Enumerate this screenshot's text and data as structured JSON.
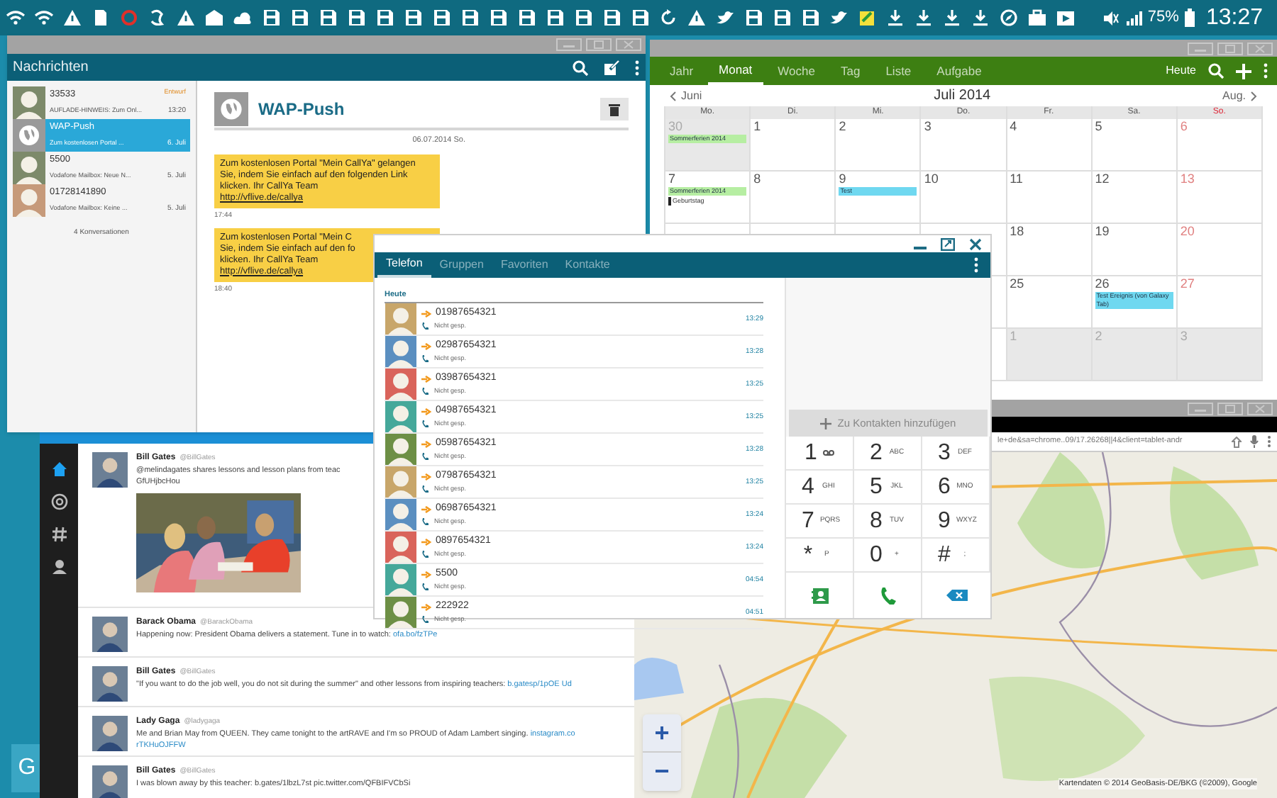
{
  "status_bar": {
    "battery": "75%",
    "time": "13:27"
  },
  "calendar": {
    "tabs": [
      {
        "label": "Jahr",
        "selected": false
      },
      {
        "label": "Monat",
        "selected": true
      },
      {
        "label": "Woche",
        "selected": false
      },
      {
        "label": "Tag",
        "selected": false
      },
      {
        "label": "Liste",
        "selected": false
      },
      {
        "label": "Aufgabe",
        "selected": false
      }
    ],
    "today": "Heute",
    "prev": "Juni",
    "month": "Juli 2014",
    "next": "Aug.",
    "weekdays": [
      "Mo.",
      "Di.",
      "Mi.",
      "Do.",
      "Fr.",
      "Sa.",
      "So."
    ],
    "weeks": [
      {
        "days": [
          {
            "day": "30",
            "other_month": true,
            "events": [
              {
                "text": "Sommerferien 2014",
                "color": "#b6eea2"
              }
            ]
          },
          {
            "day": "1",
            "other_month": false
          },
          {
            "day": "2",
            "other_month": false
          },
          {
            "day": "3",
            "other_month": false
          },
          {
            "day": "4",
            "other_month": false
          },
          {
            "day": "5",
            "other_month": false
          },
          {
            "day": "6",
            "other_month": false
          }
        ]
      },
      {
        "days": [
          {
            "day": "7",
            "other_month": false,
            "events": [
              {
                "text": "Sommerferien 2014",
                "color": "#b6eea2"
              },
              {
                "text": "Geburtstag",
                "color": "#222222"
              }
            ]
          },
          {
            "day": "8",
            "other_month": false
          },
          {
            "day": "9",
            "other_month": false,
            "events": [
              {
                "text": "Test",
                "color": "#6fd8f0"
              }
            ]
          },
          {
            "day": "10",
            "other_month": false
          },
          {
            "day": "11",
            "other_month": false
          },
          {
            "day": "12",
            "other_month": false
          },
          {
            "day": "13",
            "other_month": false
          }
        ]
      },
      {
        "days": [
          {
            "day": "18",
            "other_month": false
          },
          {
            "day": "19",
            "other_month": false
          },
          {
            "day": "20",
            "other_month": false
          }
        ]
      },
      {
        "days": [
          {
            "day": "25",
            "other_month": false
          },
          {
            "day": "26",
            "other_month": false,
            "events": [
              {
                "text": "Test Ereignis (von Galaxy Tab)",
                "color": "#6fd8f0"
              }
            ]
          },
          {
            "day": "27",
            "other_month": false
          }
        ]
      },
      {
        "days": [
          {
            "day": "1",
            "other_month": true
          },
          {
            "day": "2",
            "other_month": true
          },
          {
            "day": "3",
            "other_month": true
          }
        ]
      }
    ]
  },
  "twitter": {
    "tweets": [
      {
        "name": "Bill Gates",
        "handle": "@BillGates",
        "lines": [
          {
            "text": "@melindagates shares lessons and lesson plans from teac"
          },
          {
            "text": "GfUHjbcHou"
          }
        ],
        "picture": true
      },
      {
        "name": "Barack Obama",
        "handle": "@BarackObama",
        "lines": [
          {
            "text": "Happening now: President Obama delivers a statement. Tune in to watch:",
            "link": "ofa.bo/fzTPe"
          }
        ],
        "picture": false
      },
      {
        "name": "Bill Gates",
        "handle": "@BillGates",
        "lines": [
          {
            "text": "\"If you want to do the job well, you do not sit during the summer\" and other lessons from inspiring teachers:",
            "link": "b.gatesp/1pOE Ud"
          }
        ],
        "picture": false
      },
      {
        "name": "Lady Gaga",
        "handle": "@ladygaga",
        "lines": [
          {
            "text": "Me and Brian May from QUEEN. They came tonight to the artRAVE and I'm so PROUD of Adam Lambert singing.",
            "link": "instagram.co"
          },
          {
            "link": "rTKHuOJFFW"
          }
        ],
        "picture": false
      },
      {
        "name": "Bill Gates",
        "handle": "@BillGates",
        "lines": [
          {
            "text": "I was blown away by this teacher: b.gates/1lbzL7st pic.twitter.com/QFBIFVCbSi"
          }
        ],
        "picture": false
      }
    ]
  },
  "messages": {
    "title": "Nachrichten",
    "conversations": [
      {
        "name": "33533",
        "tag": "Entwurf",
        "snippet": "AUFLADE-HINWEIS: Zum Onl...",
        "time": "13:20",
        "selected": false,
        "kind": "person"
      },
      {
        "name": "WAP-Push",
        "snippet": "Zum kostenlosen Portal ...",
        "time": "6. Juli",
        "selected": true,
        "kind": "globe"
      },
      {
        "name": "5500",
        "snippet": "Vodafone Mailbox: Neue N...",
        "time": "5. Juli",
        "selected": false,
        "kind": "person"
      },
      {
        "name": "01728141890",
        "snippet": "Vodafone Mailbox: Keine ...",
        "time": "5. Juli",
        "selected": false,
        "kind": "person"
      }
    ],
    "count": "4 Konversationen",
    "thread": {
      "title": "WAP-Push",
      "date": "06.07.2014 So.",
      "messages": [
        {
          "lines": [
            "Zum kostenlosen Portal \"Mein CallYa\" gelangen",
            "Sie, indem Sie einfach auf den folgenden Link",
            "klicken. Ihr CallYa Team"
          ],
          "link": "http://vflive.de/callya",
          "time": "17:44"
        },
        {
          "lines": [
            "Zum kostenlosen Portal \"Mein C",
            "Sie, indem Sie einfach auf den fo",
            "klicken. Ihr CallYa Team"
          ],
          "link": "http://vflive.de/callya",
          "time": "18:40"
        }
      ]
    }
  },
  "map": {
    "url": "le+de&sa=chrome..09/17.26268||4&client=tablet-andr",
    "attribution": "Kartendaten © 2014 GeoBasis-DE/BKG (©2009), Google",
    "zoom_in": "+",
    "zoom_out": "−"
  },
  "phone": {
    "tabs": [
      {
        "label": "Telefon",
        "selected": true
      },
      {
        "label": "Gruppen",
        "selected": false
      },
      {
        "label": "Favoriten",
        "selected": false
      },
      {
        "label": "Kontakte",
        "selected": false
      }
    ],
    "section": "Heute",
    "calls": [
      {
        "number": "01987654321",
        "status": "Nicht gesp.",
        "time": "13:29",
        "color": "#c8a66a"
      },
      {
        "number": "02987654321",
        "status": "Nicht gesp.",
        "time": "13:28",
        "color": "#5b8fc0"
      },
      {
        "number": "03987654321",
        "status": "Nicht gesp.",
        "time": "13:25",
        "color": "#d9645b"
      },
      {
        "number": "04987654321",
        "status": "Nicht gesp.",
        "time": "13:25",
        "color": "#45a89a"
      },
      {
        "number": "05987654321",
        "status": "Nicht gesp.",
        "time": "13:28",
        "color": "#6d8f45"
      },
      {
        "number": "07987654321",
        "status": "Nicht gesp.",
        "time": "13:25",
        "color": "#c8a66a"
      },
      {
        "number": "06987654321",
        "status": "Nicht gesp.",
        "time": "13:24",
        "color": "#5b8fc0"
      },
      {
        "number": "0897654321",
        "status": "Nicht gesp.",
        "time": "13:24",
        "color": "#d9645b"
      },
      {
        "number": "5500",
        "status": "Nicht gesp.",
        "time": "04:54",
        "color": "#45a89a"
      },
      {
        "number": "222922",
        "status": "Nicht gesp.",
        "time": "04:51",
        "color": "#6d8f45"
      }
    ],
    "add_contact": "Zu Kontakten hinzufügen",
    "keys": [
      {
        "digit": "1",
        "kind": "voicemail"
      },
      {
        "digit": "2",
        "letters": "ABC",
        "kind": "letters"
      },
      {
        "digit": "3",
        "letters": "DEF",
        "kind": "letters"
      },
      {
        "digit": "4",
        "letters": "GHI",
        "kind": "letters"
      },
      {
        "digit": "5",
        "letters": "JKL",
        "kind": "letters"
      },
      {
        "digit": "6",
        "letters": "MNO",
        "kind": "letters"
      },
      {
        "digit": "7",
        "letters": "PQRS",
        "kind": "letters"
      },
      {
        "digit": "8",
        "letters": "TUV",
        "kind": "letters"
      },
      {
        "digit": "9",
        "letters": "WXYZ",
        "kind": "letters"
      },
      {
        "digit": "*",
        "letters": "P",
        "kind": "letters"
      },
      {
        "digit": "0",
        "letters": "+",
        "kind": "letters"
      },
      {
        "digit": "#",
        "letters": ";",
        "kind": "letters"
      }
    ]
  },
  "launcher": {
    "label": "G"
  }
}
